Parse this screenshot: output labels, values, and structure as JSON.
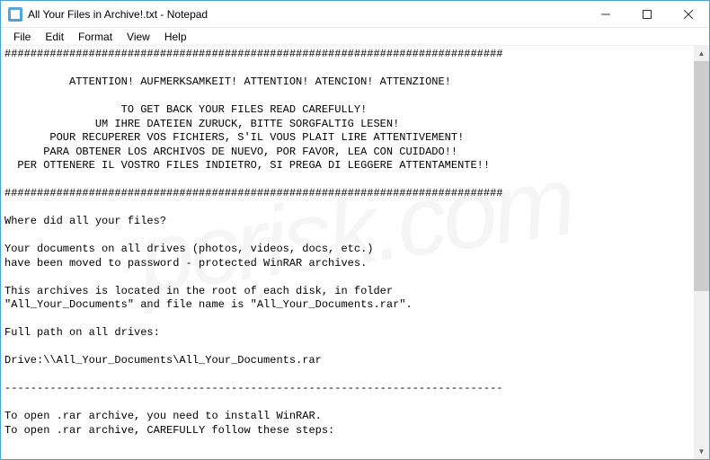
{
  "titlebar": {
    "title": "All Your Files in Archive!.txt - Notepad"
  },
  "menubar": {
    "file": "File",
    "edit": "Edit",
    "format": "Format",
    "view": "View",
    "help": "Help"
  },
  "content": {
    "text": "#############################################################################\n\n          ATTENTION! AUFMERKSAMKEIT! ATTENTION! ATENCION! ATTENZIONE!\n\n                  TO GET BACK YOUR FILES READ CAREFULLY!\n              UM IHRE DATEIEN ZURUCK, BITTE SORGFALTIG LESEN!\n       POUR RECUPERER VOS FICHIERS, S'IL VOUS PLAIT LIRE ATTENTIVEMENT!\n      PARA OBTENER LOS ARCHIVOS DE NUEVO, POR FAVOR, LEA CON CUIDADO!!\n  PER OTTENERE IL VOSTRO FILES INDIETRO, SI PREGA DI LEGGERE ATTENTAMENTE!!\n\n#############################################################################\n\nWhere did all your files?\n\nYour documents on all drives (photos, videos, docs, etc.)\nhave been moved to password - protected WinRAR archives.\n\nThis archives is located in the root of each disk, in folder\n\"All_Your_Documents\" and file name is \"All_Your_Documents.rar\".\n\nFull path on all drives:\n\nDrive:\\\\All_Your_Documents\\All_Your_Documents.rar\n\n-----------------------------------------------------------------------------\n\nTo open .rar archive, you need to install WinRAR.\nTo open .rar archive, CAREFULLY follow these steps:"
  },
  "watermark": "pcrisk.com"
}
